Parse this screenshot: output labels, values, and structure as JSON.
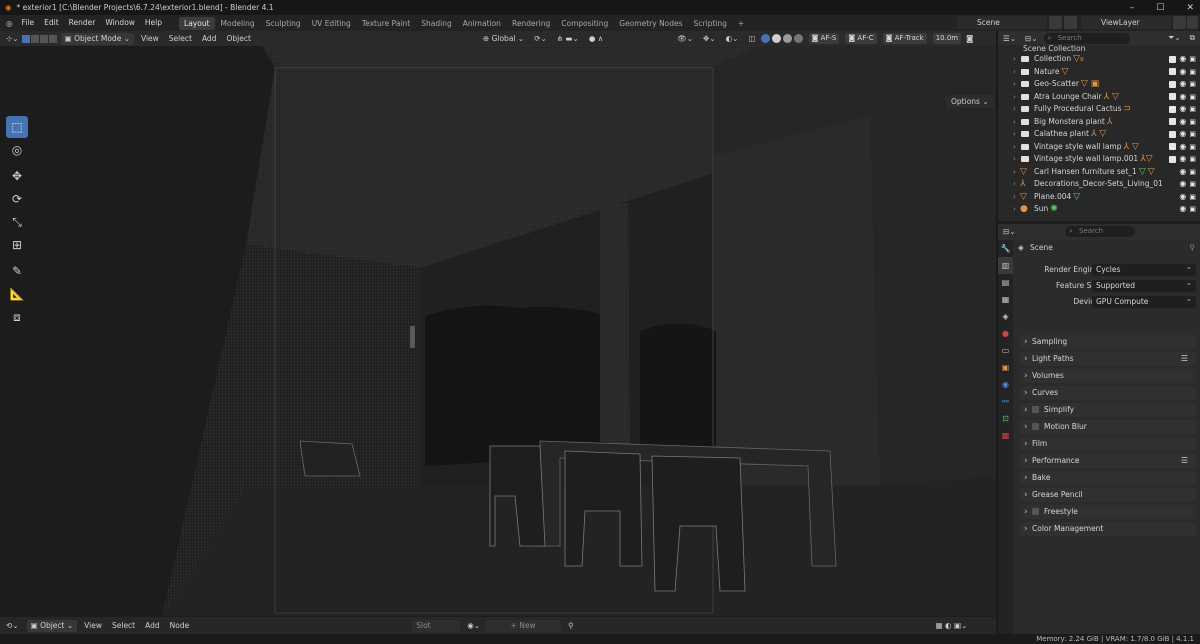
{
  "window": {
    "title": "* exterior1 [C:\\Blender Projects\\6.7.24\\exterior1.blend] - Blender 4.1",
    "controls": [
      "–",
      "☐",
      "✕"
    ]
  },
  "menus": [
    "File",
    "Edit",
    "Render",
    "Window",
    "Help"
  ],
  "workspaces": [
    "Layout",
    "Modeling",
    "Sculpting",
    "UV Editing",
    "Texture Paint",
    "Shading",
    "Animation",
    "Rendering",
    "Compositing",
    "Geometry Nodes",
    "Scripting"
  ],
  "add_workspace": "+",
  "scene_name": "Scene",
  "view_layer": "ViewLayer",
  "viewport_header": {
    "mode": "Object Mode",
    "menus": [
      "View",
      "Select",
      "Add",
      "Object"
    ],
    "orientation": "Global",
    "af_s": "AF-S",
    "af_c": "AF-C",
    "af_track": "AF-Track",
    "focal": "10.0m",
    "options": "Options"
  },
  "bottom_bar": {
    "mode": "Object",
    "menus": [
      "View",
      "Select",
      "Add",
      "Node"
    ],
    "slot": "Slot",
    "new_btn": "New"
  },
  "status": {
    "memory": "Memory: 2.24 GiB | VRAM: 1.7/8.0 GiB | 4.1.1"
  },
  "outliner": {
    "search_placeholder": "Search",
    "root": "Scene Collection",
    "items": [
      {
        "label": "Collection",
        "type": "collection"
      },
      {
        "label": "Nature",
        "type": "collection"
      },
      {
        "label": "Geo-Scatter",
        "type": "collection"
      },
      {
        "label": "Atra Lounge Chair",
        "type": "collection"
      },
      {
        "label": "Fully Procedural Cactus",
        "type": "collection"
      },
      {
        "label": "Big Monstera plant",
        "type": "collection"
      },
      {
        "label": "Calathea plant",
        "type": "collection"
      },
      {
        "label": "Vintage style wall lamp",
        "type": "collection"
      },
      {
        "label": "Vintage style wall lamp.001",
        "type": "collection"
      },
      {
        "label": "Carl Hansen furniture set_1",
        "type": "object"
      },
      {
        "label": "Decorations_Decor-Sets_Living_01",
        "type": "object"
      },
      {
        "label": "Plane.004",
        "type": "object"
      },
      {
        "label": "Sun",
        "type": "light"
      }
    ]
  },
  "properties": {
    "search_placeholder": "Search",
    "context": "Scene",
    "fields": [
      {
        "label": "Render Engine",
        "value": "Cycles"
      },
      {
        "label": "Feature Set",
        "value": "Supported"
      },
      {
        "label": "Device",
        "value": "GPU Compute"
      }
    ],
    "panels": [
      "Sampling",
      "Light Paths",
      "Volumes",
      "Curves",
      "Simplify",
      "Motion Blur",
      "Film",
      "Performance",
      "Bake",
      "Grease Pencil",
      "Freestyle",
      "Color Management"
    ]
  }
}
